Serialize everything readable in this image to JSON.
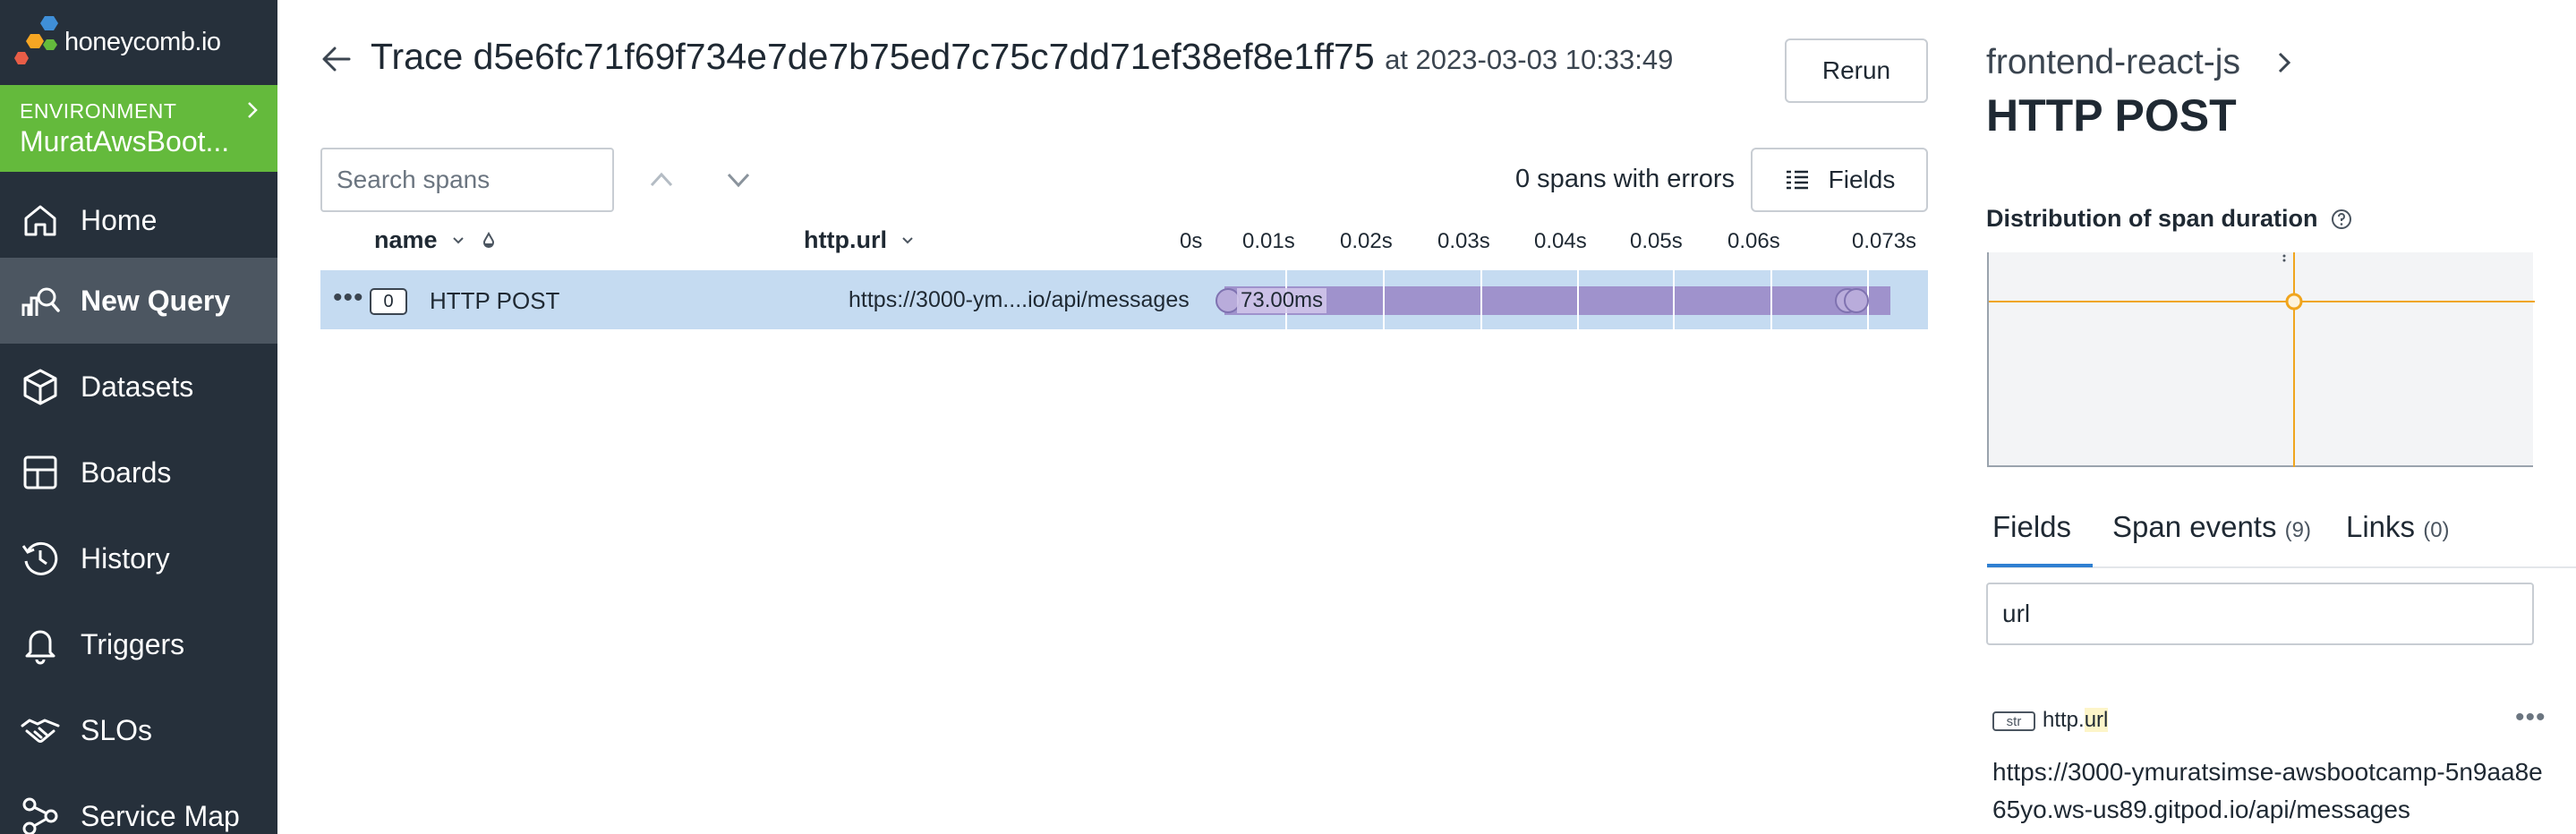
{
  "sidebar": {
    "logo_text": "honeycomb.io",
    "environment": {
      "label": "ENVIRONMENT",
      "name": "MuratAwsBoot..."
    },
    "items": [
      {
        "label": "Home",
        "icon": "home-icon",
        "active": false
      },
      {
        "label": "New Query",
        "icon": "query-icon",
        "active": true
      },
      {
        "label": "Datasets",
        "icon": "dataset-icon",
        "active": false
      },
      {
        "label": "Boards",
        "icon": "boards-icon",
        "active": false
      },
      {
        "label": "History",
        "icon": "history-icon",
        "active": false
      },
      {
        "label": "Triggers",
        "icon": "bell-icon",
        "active": false
      },
      {
        "label": "SLOs",
        "icon": "handshake-icon",
        "active": false
      },
      {
        "label": "Service Map",
        "icon": "service-map-icon",
        "active": false
      }
    ]
  },
  "header": {
    "title": "Trace d5e6fc71f69f734e7de7b75ed7c75c7dd71ef38ef8e1ff75",
    "timestamp": "at 2023-03-03 10:33:49",
    "rerun_label": "Rerun"
  },
  "toolbar": {
    "search_placeholder": "Search spans",
    "errors_text": "0 spans with errors",
    "fields_label": "Fields"
  },
  "table": {
    "columns": {
      "name": "name",
      "url": "http.url"
    },
    "ticks": [
      "0s",
      "0.01s",
      "0.02s",
      "0.03s",
      "0.04s",
      "0.05s",
      "0.06s",
      "0.073s"
    ],
    "rows": [
      {
        "count": "0",
        "name": "HTTP POST",
        "url": "https://3000-ym....io/api/messages",
        "duration": "73.00ms"
      }
    ]
  },
  "panel": {
    "service": "frontend-react-js",
    "span_name": "HTTP POST",
    "distribution_label": "Distribution of span duration",
    "tabs": [
      {
        "label": "Fields",
        "count": ""
      },
      {
        "label": "Span events",
        "count": "(9)"
      },
      {
        "label": "Links",
        "count": "(0)"
      }
    ],
    "filter_value": "url",
    "field": {
      "type": "str",
      "name_prefix": "http.",
      "name_match": "url",
      "value": "https://3000-ymuratsimse-awsbootcamp-5n9aa8e65yo.ws-us89.gitpod.io/api/messages"
    }
  },
  "colors": {
    "sidebar_bg": "#26303b",
    "environment_bg": "#64ba3c",
    "selected_row": "#c5dbf1",
    "span_bar": "#9f92cc",
    "tab_active": "#2f7fd1",
    "histogram_line": "#f0a51e"
  }
}
